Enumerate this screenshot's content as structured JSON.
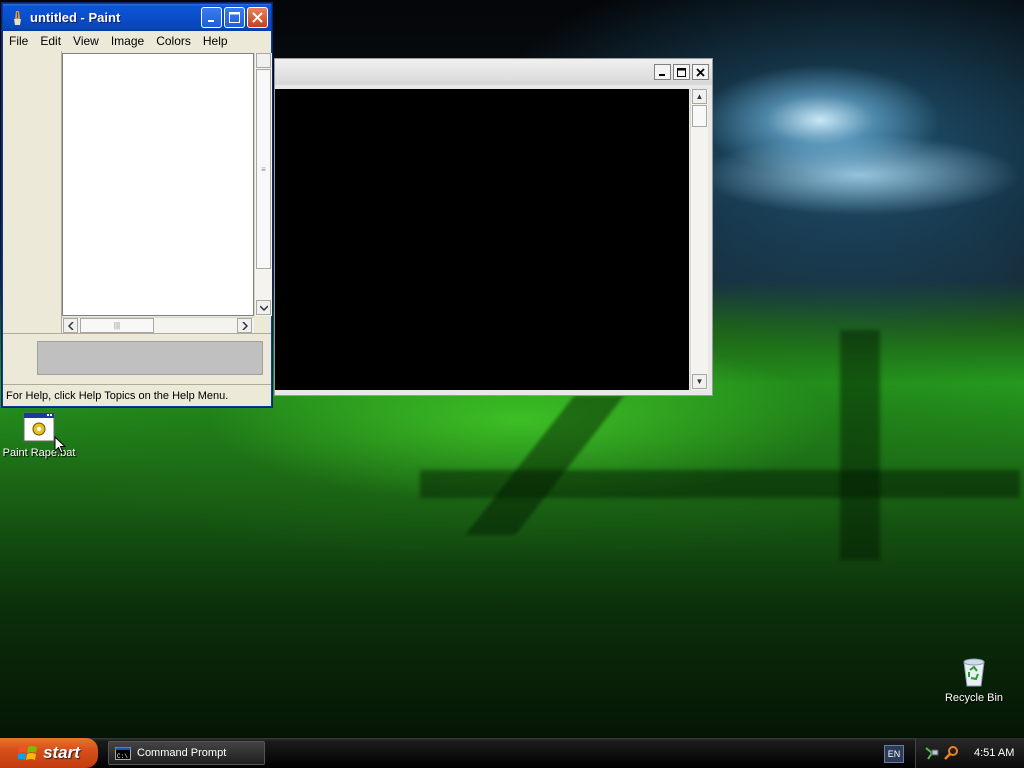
{
  "paint_window": {
    "title": "untitled - Paint",
    "menu": [
      "File",
      "Edit",
      "View",
      "Image",
      "Colors",
      "Help"
    ],
    "status_text": "For Help, click Help Topics on the Help Menu."
  },
  "cmd_window": {
    "title": ""
  },
  "desktop": {
    "icons": [
      {
        "label": "Paint Rape.bat",
        "icon": "batch-file-icon"
      },
      {
        "label": "Recycle Bin",
        "icon": "recycle-bin-icon"
      }
    ]
  },
  "taskbar": {
    "start_label": "start",
    "tasks": [
      {
        "label": "Command Prompt",
        "icon": "cmd-icon"
      }
    ],
    "language": "EN",
    "clock": "4:51 AM"
  },
  "colors": {
    "title_active": "#0a4ecb",
    "start_button": "#d5501a",
    "taskbar": "#0d0d0d"
  }
}
